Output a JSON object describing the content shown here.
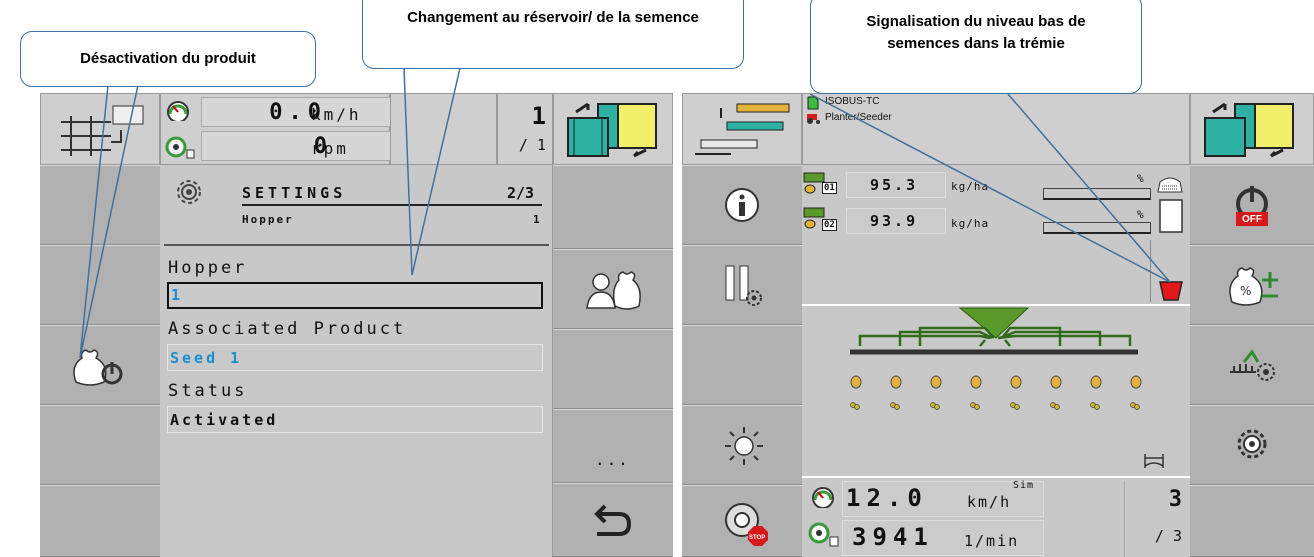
{
  "callouts": {
    "deactivation": "Désactivation du produit",
    "change_hopper": "Changement au réservoir/ de la semence",
    "low_level": "Signalisation du niveau bas de semences dans la trémie"
  },
  "left_terminal": {
    "speed_value": "0.0",
    "speed_unit": "km/h",
    "rpm_value": "0",
    "rpm_unit": "rpm",
    "page_current": "1",
    "page_total": "/ 1",
    "settings_title": "SETTINGS",
    "settings_page": "2/3",
    "settings_sub": "Hopper",
    "settings_sub_num": "1",
    "field_hopper_label": "Hopper",
    "field_hopper_value": "1",
    "field_product_label": "Associated Product",
    "field_product_value": "Seed 1",
    "field_status_label": "Status",
    "field_status_value": "Activated",
    "more_label": "..."
  },
  "right_terminal": {
    "isobus_label": "ISOBUS-TC",
    "planter_label": "Planter/Seeder",
    "rate1_value": "95.3",
    "rate1_unit": "kg/ha",
    "rate1_sensor": "01",
    "rate2_value": "93.9",
    "rate2_unit": "kg/ha",
    "rate2_sensor": "02",
    "pct1": "%",
    "pct2": "%",
    "speed_value": "12.0",
    "speed_unit": "km/h",
    "sim_label": "Sim",
    "rpm_value": "3941",
    "rpm_unit": "1/min",
    "page_current": "3",
    "page_total": "/ 3",
    "off_badge": "OFF",
    "stop_badge": "STOP"
  },
  "colors": {
    "accent_blue": "#1a8fd0",
    "hopper_green": "#5a9a2a",
    "alarm_red": "#e3181b",
    "panel_gray": "#c8c8c8"
  }
}
